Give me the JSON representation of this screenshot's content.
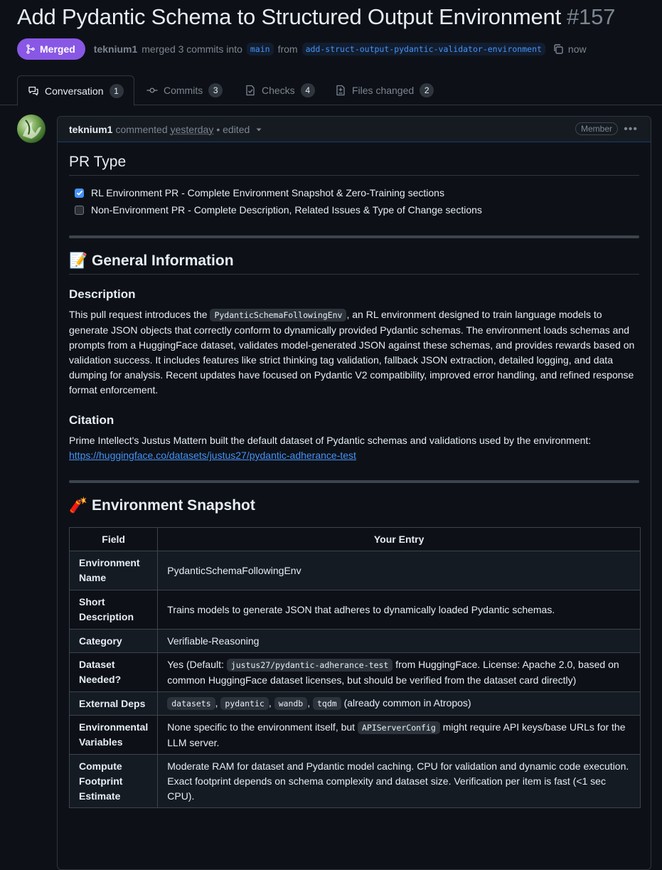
{
  "pr": {
    "title": "Add Pydantic Schema to Structured Output Environment",
    "number": "#157",
    "state": "Merged",
    "author": "teknium1",
    "merge_text": "merged 3 commits into",
    "base_branch": "main",
    "from_text": "from",
    "head_branch": "add-struct-output-pydantic-validator-environment",
    "time": "now"
  },
  "tabs": [
    {
      "label": "Conversation",
      "count": "1",
      "icon": "comment-discussion-icon"
    },
    {
      "label": "Commits",
      "count": "3",
      "icon": "commit-icon"
    },
    {
      "label": "Checks",
      "count": "4",
      "icon": "checklist-icon"
    },
    {
      "label": "Files changed",
      "count": "2",
      "icon": "file-diff-icon"
    }
  ],
  "comment": {
    "author": "teknium1",
    "action": "commented",
    "when": "yesterday",
    "edited": "• edited",
    "role": "Member",
    "pr_type_heading": "PR Type",
    "checkboxes": [
      {
        "label": "RL Environment PR - Complete Environment Snapshot & Zero-Training sections",
        "checked": true
      },
      {
        "label": "Non-Environment PR - Complete Description, Related Issues & Type of Change sections",
        "checked": false
      }
    ],
    "general": {
      "emoji": "📝",
      "heading": "General Information",
      "description_heading": "Description",
      "desc_pre": "This pull request introduces the ",
      "desc_code": "PydanticSchemaFollowingEnv",
      "desc_post": ", an RL environment designed to train language models to generate JSON objects that correctly conform to dynamically provided Pydantic schemas. The environment loads schemas and prompts from a HuggingFace dataset, validates model-generated JSON against these schemas, and provides rewards based on validation success. It includes features like strict thinking tag validation, fallback JSON extraction, detailed logging, and data dumping for analysis. Recent updates have focused on Pydantic V2 compatibility, improved error handling, and refined response format enforcement.",
      "citation_heading": "Citation",
      "citation_text": "Prime Intellect's Justus Mattern built the default dataset of Pydantic schemas and validations used by the environment:",
      "citation_link": "https://huggingface.co/datasets/justus27/pydantic-adherance-test"
    },
    "snapshot": {
      "emoji": "🧨",
      "heading": "Environment Snapshot",
      "col_field": "Field",
      "col_entry": "Your Entry",
      "rows": {
        "env_name": {
          "field": "Environment Name",
          "entry": "PydanticSchemaFollowingEnv"
        },
        "short_desc": {
          "field": "Short Description",
          "entry": "Trains models to generate JSON that adheres to dynamically loaded Pydantic schemas."
        },
        "category": {
          "field": "Category",
          "entry": "Verifiable-Reasoning"
        },
        "dataset": {
          "field": "Dataset Needed?",
          "pre": "Yes (Default: ",
          "code": "justus27/pydantic-adherance-test",
          "post": " from HuggingFace. License: Apache 2.0, based on common HuggingFace dataset licenses, but should be verified from the dataset card directly)"
        },
        "deps": {
          "field": "External Deps",
          "codes": [
            "datasets",
            "pydantic",
            "wandb",
            "tqdm"
          ],
          "sep": ",",
          "post": "(already common in Atropos)"
        },
        "env_vars": {
          "field": "Environmental Variables",
          "pre": "None specific to the environment itself, but ",
          "code": "APIServerConfig",
          "post": " might require API keys/base URLs for the LLM server."
        },
        "compute": {
          "field": "Compute Footprint Estimate",
          "entry": "Moderate RAM for dataset and Pydantic model caching. CPU for validation and dynamic code execution. Exact footprint depends on schema complexity and dataset size. Verification per item is fast (<1 sec CPU)."
        }
      }
    }
  },
  "colors": {
    "background": "#0d1117",
    "merged": "#8957e5",
    "link": "#4493f8",
    "border": "#30363d"
  }
}
